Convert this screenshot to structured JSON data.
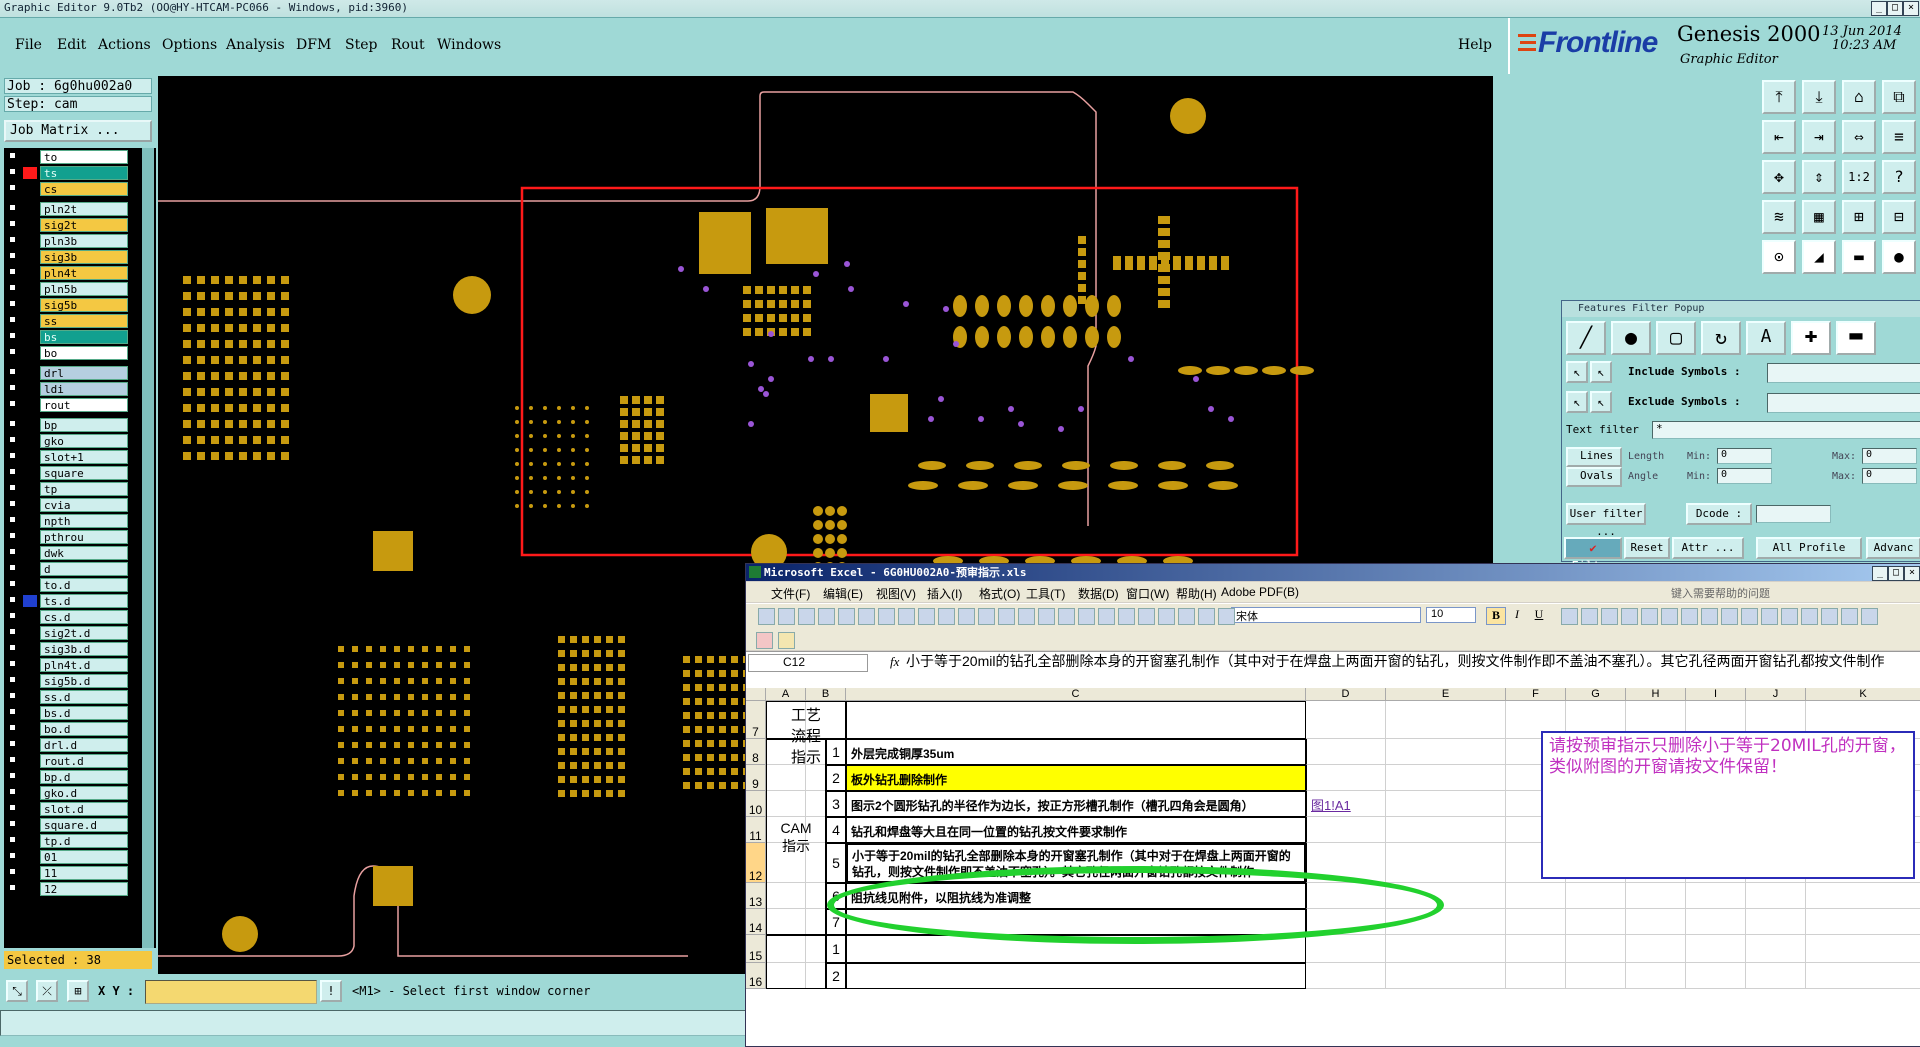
{
  "window": {
    "title": "Graphic Editor 9.0Tb2  (OO@HY-HTCAM-PC066 - Windows, pid:3960)",
    "min": "_",
    "max": "□",
    "close": "×"
  },
  "menu": [
    "File",
    "Edit",
    "Actions",
    "Options",
    "Analysis",
    "DFM",
    "Step",
    "Rout",
    "Windows"
  ],
  "help": "Help",
  "brand": {
    "logo": "Frontline",
    "product": "Genesis 2000",
    "sub": "Graphic Editor",
    "date": "13 Jun 2014",
    "time": "10:23 AM"
  },
  "job": {
    "job": "Job : 6g0hu002a0",
    "step": "Step: cam",
    "matrix_button": "Job Matrix ..."
  },
  "colors": {
    "signal": "#f4c842",
    "mask": "#12a08f",
    "plane": "#cfeeed",
    "drill": "#b5cfe0",
    "white": "#ffffff",
    "pad": "#c79a0f",
    "via": "#9a55d6",
    "window": "#ff1a1a",
    "highlight": "#22d12e"
  },
  "layers": [
    {
      "name": "to",
      "color": "white",
      "mark": ""
    },
    {
      "name": "ts",
      "color": "mask",
      "mark": "red"
    },
    {
      "name": "cs",
      "color": "signal",
      "mark": ""
    },
    {
      "name": "pln2t",
      "color": "plane",
      "mark": ""
    },
    {
      "name": "sig2t",
      "color": "signal",
      "mark": ""
    },
    {
      "name": "pln3b",
      "color": "plane",
      "mark": ""
    },
    {
      "name": "sig3b",
      "color": "signal",
      "mark": ""
    },
    {
      "name": "pln4t",
      "color": "signal",
      "mark": ""
    },
    {
      "name": "pln5b",
      "color": "plane",
      "mark": ""
    },
    {
      "name": "sig5b",
      "color": "signal",
      "mark": ""
    },
    {
      "name": "ss",
      "color": "signal",
      "mark": ""
    },
    {
      "name": "bs",
      "color": "mask",
      "mark": ""
    },
    {
      "name": "bo",
      "color": "white",
      "mark": ""
    },
    {
      "name": "drl",
      "color": "drill",
      "mark": ""
    },
    {
      "name": "ldi",
      "color": "drill",
      "mark": ""
    },
    {
      "name": "rout",
      "color": "white",
      "mark": ""
    },
    {
      "name": "bp",
      "color": "plane",
      "mark": ""
    },
    {
      "name": "gko",
      "color": "plane",
      "mark": ""
    },
    {
      "name": "slot+1",
      "color": "plane",
      "mark": ""
    },
    {
      "name": "square",
      "color": "plane",
      "mark": ""
    },
    {
      "name": "tp",
      "color": "plane",
      "mark": ""
    },
    {
      "name": "cvia",
      "color": "plane",
      "mark": ""
    },
    {
      "name": "npth",
      "color": "plane",
      "mark": ""
    },
    {
      "name": "pthrou",
      "color": "plane",
      "mark": ""
    },
    {
      "name": "dwk",
      "color": "plane",
      "mark": ""
    },
    {
      "name": "d",
      "color": "plane",
      "mark": ""
    },
    {
      "name": "to.d",
      "color": "plane",
      "mark": "",
      "edit": "✎"
    },
    {
      "name": "ts.d",
      "color": "plane",
      "mark": "blue",
      "edit": "✎"
    },
    {
      "name": "cs.d",
      "color": "plane",
      "mark": "",
      "edit": "✎"
    },
    {
      "name": "sig2t.d",
      "color": "plane",
      "mark": "",
      "edit": "✎"
    },
    {
      "name": "sig3b.d",
      "color": "plane",
      "mark": "",
      "edit": "✎"
    },
    {
      "name": "pln4t.d",
      "color": "plane",
      "mark": "",
      "edit": "✎"
    },
    {
      "name": "sig5b.d",
      "color": "plane",
      "mark": "",
      "edit": "✎"
    },
    {
      "name": "ss.d",
      "color": "plane",
      "mark": "",
      "edit": "✎"
    },
    {
      "name": "bs.d",
      "color": "plane",
      "mark": "",
      "edit": "✎"
    },
    {
      "name": "bo.d",
      "color": "plane",
      "mark": "",
      "edit": "✎"
    },
    {
      "name": "drl.d",
      "color": "plane",
      "mark": ""
    },
    {
      "name": "rout.d",
      "color": "plane",
      "mark": ""
    },
    {
      "name": "bp.d",
      "color": "plane",
      "mark": ""
    },
    {
      "name": "gko.d",
      "color": "plane",
      "mark": ""
    },
    {
      "name": "slot.d",
      "color": "plane",
      "mark": ""
    },
    {
      "name": "square.d",
      "color": "plane",
      "mark": ""
    },
    {
      "name": "tp.d",
      "color": "plane",
      "mark": ""
    },
    {
      "name": "01",
      "color": "plane",
      "mark": ""
    },
    {
      "name": "11",
      "color": "plane",
      "mark": ""
    },
    {
      "name": "12",
      "color": "plane",
      "mark": ""
    }
  ],
  "status": {
    "selected": "Selected : 38",
    "xy_label": "X Y :",
    "xy_value": "",
    "prompt": "<M1> - Select first window corner"
  },
  "features_filter": {
    "title": "Features Filter Popup",
    "include": "Include Symbols :",
    "exclude": "Exclude Symbols :",
    "text_filter": "Text filter",
    "text_filter_value": "*",
    "lines": "Lines",
    "ovals": "Ovals",
    "length": "Length",
    "angle": "Angle",
    "min": "Min:",
    "max": "Max:",
    "min_val": "0",
    "max_val": "0",
    "user_filter": "User filter ...",
    "dcode": "Dcode :",
    "filter": "Filter",
    "reset": "Reset",
    "attr": "Attr ...",
    "all_profile": "All Profile",
    "advanced": "Advanc"
  },
  "excel": {
    "title": "Microsoft Excel - 6G0HU002A0-预审指示.xls",
    "menu": [
      "文件(F)",
      "编辑(E)",
      "视图(V)",
      "插入(I)",
      "格式(O)",
      "工具(T)",
      "数据(D)",
      "窗口(W)",
      "帮助(H)",
      "Adobe PDF(B)"
    ],
    "help_search": "键入需要帮助的问题",
    "font": "宋体",
    "size": "10",
    "name_box": "C12",
    "fx": "fx",
    "formula": "小于等于20mil的钻孔全部删除本身的开窗塞孔制作（其中对于在焊盘上两面开窗的钻孔，则按文件制作即不盖油不塞孔）。其它孔径两面开窗钻孔都按文件制作",
    "columns": [
      "A",
      "B",
      "C",
      "D",
      "E",
      "F",
      "G",
      "H",
      "I",
      "J",
      "K"
    ],
    "rows": [
      "7",
      "8",
      "9",
      "10",
      "11",
      "12",
      "13",
      "14",
      "15",
      "16"
    ],
    "header_text": "工艺流程指示",
    "group_label": "CAM指示",
    "items": [
      {
        "n": "1",
        "text": "外层完成铜厚35um"
      },
      {
        "n": "2",
        "text": "板外钻孔删除制作"
      },
      {
        "n": "3",
        "text": "图示2个圆形钻孔的半径作为边长，按正方形槽孔制作（槽孔四角会是圆角）",
        "link": "图1!A1"
      },
      {
        "n": "4",
        "text": "钻孔和焊盘等大且在同一位置的钻孔按文件要求制作"
      },
      {
        "n": "5",
        "text": "小于等于20mil的钻孔全部删除本身的开窗塞孔制作（其中对于在焊盘上两面开窗的钻孔，则按文件制作即不盖油不塞孔）。其它孔径两面开窗钻孔都按文件制作"
      },
      {
        "n": "6",
        "text": "阻抗线见附件，以阻抗线为准调整"
      },
      {
        "n": "7",
        "text": ""
      }
    ],
    "items2": [
      {
        "n": "1"
      },
      {
        "n": "2"
      }
    ],
    "comment": "请按预审指示只删除小于等于20MIL孔的开窗，类似附图的开窗请按文件保留！"
  }
}
